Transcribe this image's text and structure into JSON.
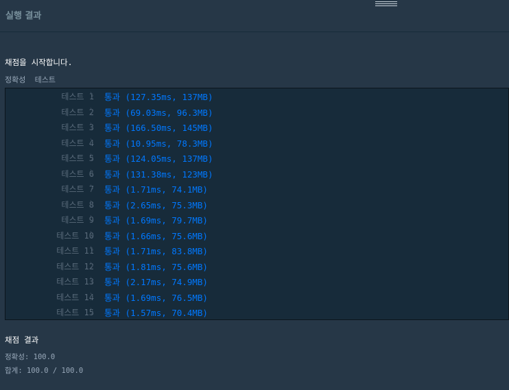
{
  "panel": {
    "title": "실행 결과"
  },
  "console": {
    "start_message": "채점을 시작합니다.",
    "category_line": "정확성  테스트",
    "tests": [
      {
        "label": "테스트 1",
        "status": "통과",
        "detail": "(127.35ms, 137MB)"
      },
      {
        "label": "테스트 2",
        "status": "통과",
        "detail": "(69.03ms, 96.3MB)"
      },
      {
        "label": "테스트 3",
        "status": "통과",
        "detail": "(166.50ms, 145MB)"
      },
      {
        "label": "테스트 4",
        "status": "통과",
        "detail": "(10.95ms, 78.3MB)"
      },
      {
        "label": "테스트 5",
        "status": "통과",
        "detail": "(124.05ms, 137MB)"
      },
      {
        "label": "테스트 6",
        "status": "통과",
        "detail": "(131.38ms, 123MB)"
      },
      {
        "label": "테스트 7",
        "status": "통과",
        "detail": "(1.71ms, 74.1MB)"
      },
      {
        "label": "테스트 8",
        "status": "통과",
        "detail": "(2.65ms, 75.3MB)"
      },
      {
        "label": "테스트 9",
        "status": "통과",
        "detail": "(1.69ms, 79.7MB)"
      },
      {
        "label": "테스트 10",
        "status": "통과",
        "detail": "(1.66ms, 75.6MB)"
      },
      {
        "label": "테스트 11",
        "status": "통과",
        "detail": "(1.71ms, 83.8MB)"
      },
      {
        "label": "테스트 12",
        "status": "통과",
        "detail": "(1.81ms, 75.6MB)"
      },
      {
        "label": "테스트 13",
        "status": "통과",
        "detail": "(2.17ms, 74.9MB)"
      },
      {
        "label": "테스트 14",
        "status": "통과",
        "detail": "(1.69ms, 76.5MB)"
      },
      {
        "label": "테스트 15",
        "status": "통과",
        "detail": "(1.57ms, 70.4MB)"
      }
    ],
    "summary_title": "채점 결과",
    "accuracy": "정확성: 100.0",
    "total": "합계: 100.0 / 100.0"
  },
  "icons": {
    "resize_handle": "resize-handle-icon",
    "chevron": "chevron-right-icon"
  },
  "colors": {
    "background": "#263747",
    "results_background": "#172b3a",
    "pass": "#0078ff",
    "muted": "#5a6b7b"
  }
}
